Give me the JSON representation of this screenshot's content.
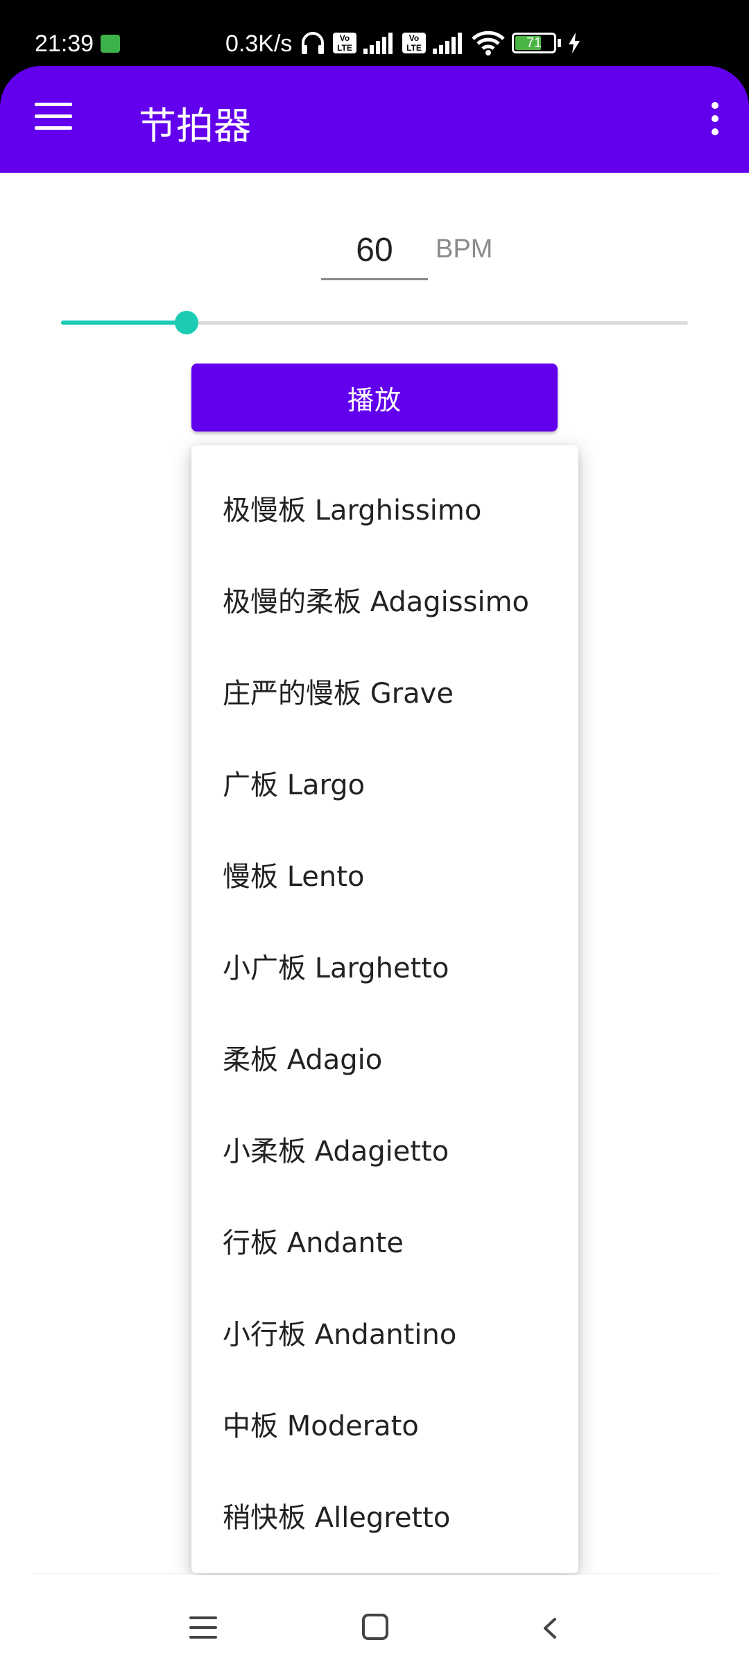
{
  "status_bar": {
    "time": "21:39",
    "network_speed": "0.3K/s",
    "battery_level": "71",
    "battery_fraction": 0.71,
    "icons": [
      "android-icon",
      "headphones-icon",
      "volte-icon",
      "signal-icon",
      "volte-icon",
      "signal-icon",
      "wifi-icon",
      "battery-icon",
      "charging-icon"
    ],
    "volte_label": "Vo\nLTE"
  },
  "app_bar": {
    "title": "节拍器",
    "background_color": "#6200ee",
    "menu_icon": "menu-icon",
    "overflow_icon": "more-vert-icon"
  },
  "bpm": {
    "value": "60",
    "unit": "BPM"
  },
  "slider": {
    "value_fraction": 0.2,
    "accent_color": "#1bcbb4"
  },
  "play_button": {
    "label": "播放"
  },
  "tempo_menu": {
    "items": [
      "极慢板 Larghissimo",
      "极慢的柔板 Adagissimo",
      "庄严的慢板 Grave",
      "广板 Largo",
      "慢板 Lento",
      "小广板 Larghetto",
      "柔板 Adagio",
      "小柔板 Adagietto",
      "行板 Andante",
      "小行板 Andantino",
      "中板 Moderato",
      "稍快板 Allegretto"
    ]
  },
  "nav_bar": {
    "icons": [
      "recent-apps-icon",
      "home-icon",
      "back-icon"
    ]
  }
}
